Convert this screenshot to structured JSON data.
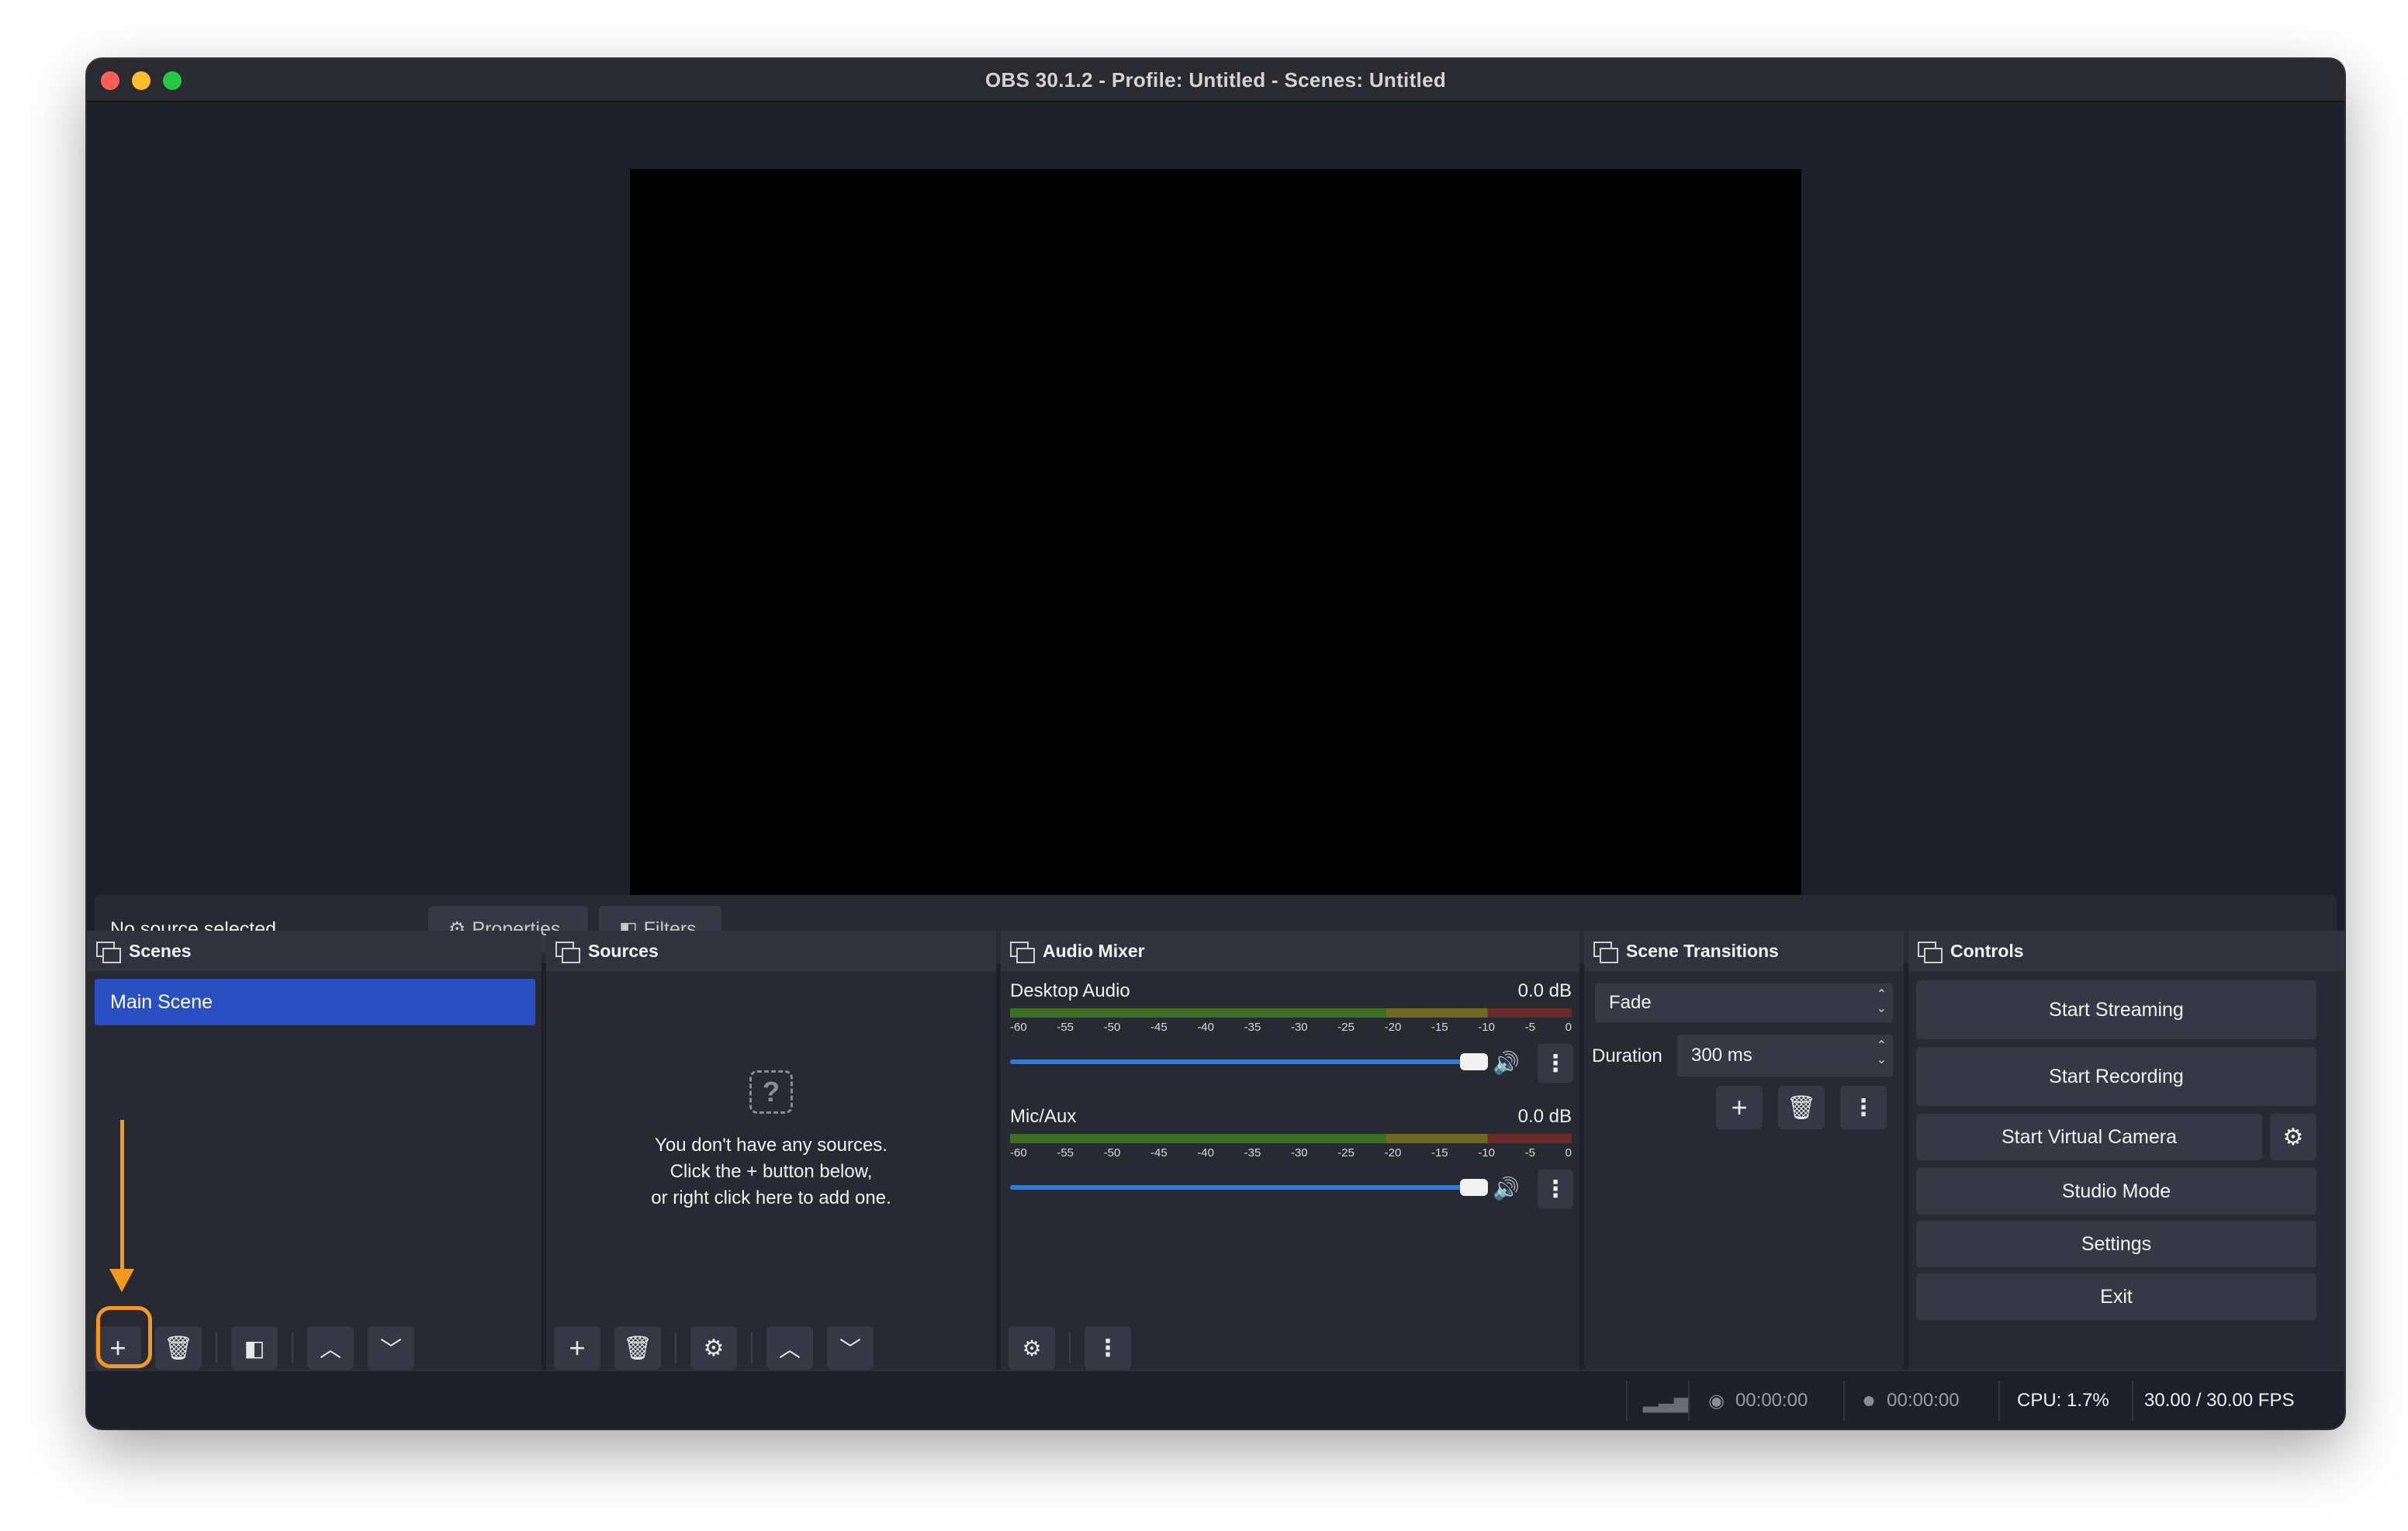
{
  "window": {
    "title": "OBS 30.1.2 - Profile: Untitled - Scenes: Untitled"
  },
  "source_bar": {
    "status": "No source selected",
    "properties_label": "Properties",
    "filters_label": "Filters"
  },
  "scenes": {
    "header": "Scenes",
    "items": [
      "Main Scene"
    ],
    "selected": "Main Scene"
  },
  "sources": {
    "header": "Sources",
    "empty_line1": "You don't have any sources.",
    "empty_line2": "Click the + button below,",
    "empty_line3": "or right click here to add one."
  },
  "audio_mixer": {
    "header": "Audio Mixer",
    "channels": [
      {
        "name": "Desktop Audio",
        "level": "0.0 dB",
        "volume_fraction": 1.0
      },
      {
        "name": "Mic/Aux",
        "level": "0.0 dB",
        "volume_fraction": 1.0
      }
    ],
    "ticks": [
      "-60",
      "-55",
      "-50",
      "-45",
      "-40",
      "-35",
      "-30",
      "-25",
      "-20",
      "-15",
      "-10",
      "-5",
      "0"
    ]
  },
  "scene_transitions": {
    "header": "Scene Transitions",
    "transition": "Fade",
    "duration_label": "Duration",
    "duration_value": "300 ms"
  },
  "controls": {
    "header": "Controls",
    "start_streaming": "Start Streaming",
    "start_recording": "Start Recording",
    "start_virtual_camera": "Start Virtual Camera",
    "studio_mode": "Studio Mode",
    "settings": "Settings",
    "exit": "Exit"
  },
  "status": {
    "stream_time": "00:00:00",
    "record_time": "00:00:00",
    "cpu": "CPU: 1.7%",
    "fps": "30.00 / 30.00 FPS"
  },
  "colors": {
    "accent": "#2a4fc2",
    "highlight": "#f39a1e",
    "background": "#1d1f2a"
  }
}
